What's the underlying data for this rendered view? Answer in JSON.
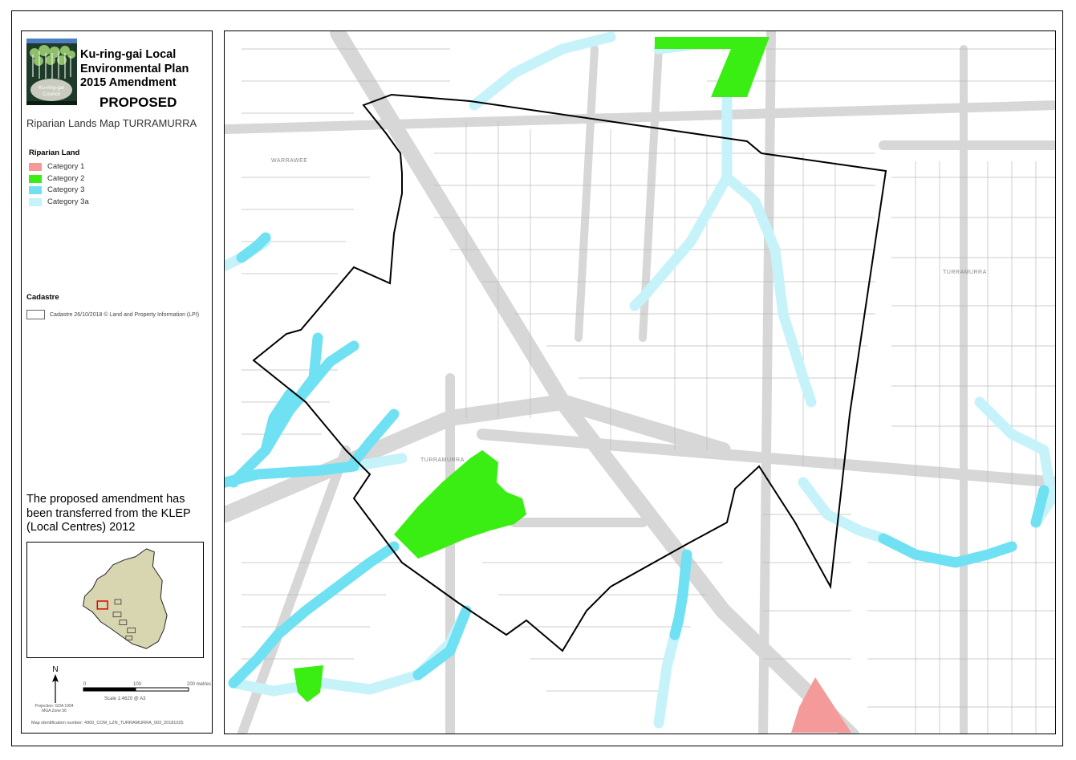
{
  "header": {
    "title_lines": [
      "Ku-ring-gai Local",
      "Environmental Plan",
      "2015 Amendment"
    ],
    "status": "PROPOSED",
    "map_title": "Riparian Lands Map TURRAMURRA",
    "logo_text": [
      "Ku-ring-gai",
      "Council"
    ]
  },
  "legend": {
    "riparian_heading": "Riparian Land",
    "items": [
      {
        "label": "Category 1",
        "color": "#f59a9a"
      },
      {
        "label": "Category 2",
        "color": "#3aee13"
      },
      {
        "label": "Category 3",
        "color": "#6fe1f2"
      },
      {
        "label": "Category 3a",
        "color": "#c6f3fa"
      }
    ],
    "cadastre_heading": "Cadastre",
    "cadastre_label": "Cadastre 26/10/2018 © Land and Property Information (LPI)"
  },
  "note": "The proposed amendment has been transferred from the KLEP (Local Centres) 2012",
  "north_label": "N",
  "projection": [
    "Projection: GDA 1994",
    "MGA Zone 56"
  ],
  "scale": {
    "ticks": [
      "0",
      "100",
      "200 metres"
    ],
    "text": "Scale  1:4620  @ A3"
  },
  "map_id": "Map identification number: 4900_COM_LZN_TURRAMURRA_003_20181025",
  "map_labels": {
    "warrawee": "WARRAWEE",
    "turramurra_east": "TURRAMURRA",
    "turramurra_centre": "TURRAMURRA"
  }
}
